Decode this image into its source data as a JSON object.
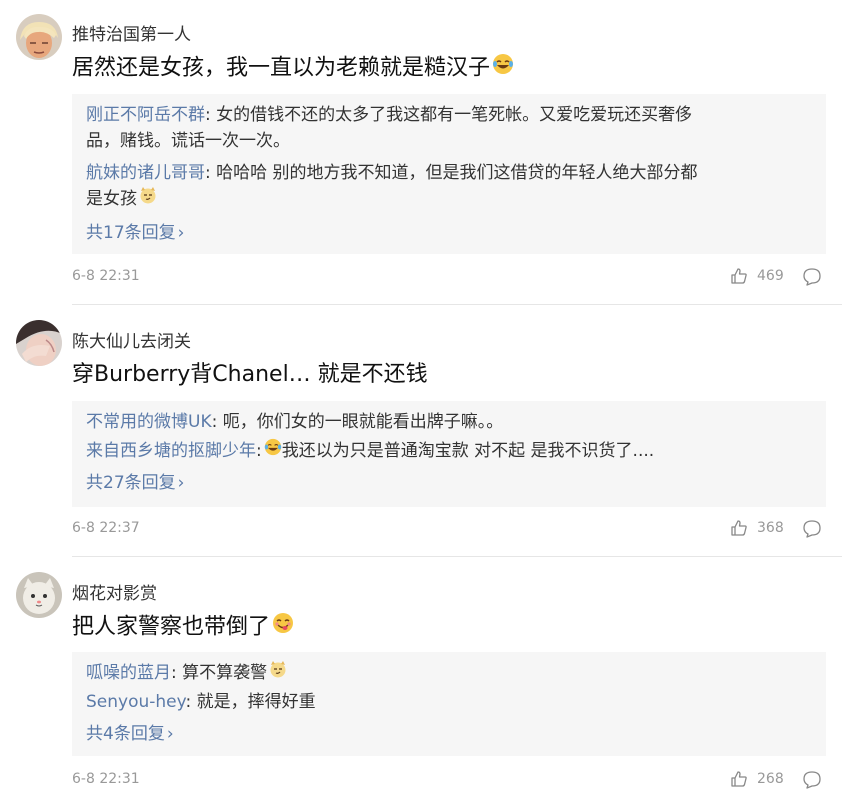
{
  "comments": [
    {
      "username": "推特治国第一人",
      "content": "居然还是女孩，我一直以为老赖就是糙汉子",
      "replies": [
        {
          "name": "刚正不阿岳不群",
          "sep": ":",
          "text": " 女的借钱不还的太多了我这都有一笔死帐。又爱吃爱玩还买奢侈",
          "text2": "品，赌钱。谎话一次一次。"
        },
        {
          "name": "航妹的诸儿哥哥",
          "sep": ":",
          "text": " 哈哈哈 别的地方我不知道，但是我们这借贷的年轻人绝大部分都",
          "text2": "是女孩"
        }
      ],
      "more": "共17条回复",
      "time": "6-8 22:31",
      "likes": "469"
    },
    {
      "username": "陈大仙儿去闭关",
      "content": "穿Burberry背Chanel… 就是不还钱",
      "replies": [
        {
          "name": "不常用的微博UK",
          "sep": ":",
          "text": " 呃，你们女的一眼就能看出牌子嘛。。"
        },
        {
          "name": "来自西乡塘的抠脚少年",
          "sep": ":",
          "text": "我还以为只是普通淘宝款 对不起 是我不识货了...."
        }
      ],
      "more": "共27条回复",
      "time": "6-8 22:37",
      "likes": "368"
    },
    {
      "username": "烟花对影赏",
      "content": "把人家警察也带倒了",
      "replies": [
        {
          "name": "呱噪的蓝月",
          "sep": ":",
          "text": " 算不算袭警"
        },
        {
          "name": "Senyou-hey",
          "sep": ":",
          "text": " 就是，摔得好重"
        }
      ],
      "more": "共4条回复",
      "time": "6-8 22:31",
      "likes": "268"
    }
  ],
  "colors": {
    "link": "#5b7aa8",
    "replybox": "#f6f6f6",
    "meta": "#999999"
  },
  "icons": {
    "like": "thumbs-up-icon",
    "comment": "speech-bubble-icon",
    "chevron": "chevron-right-icon"
  }
}
